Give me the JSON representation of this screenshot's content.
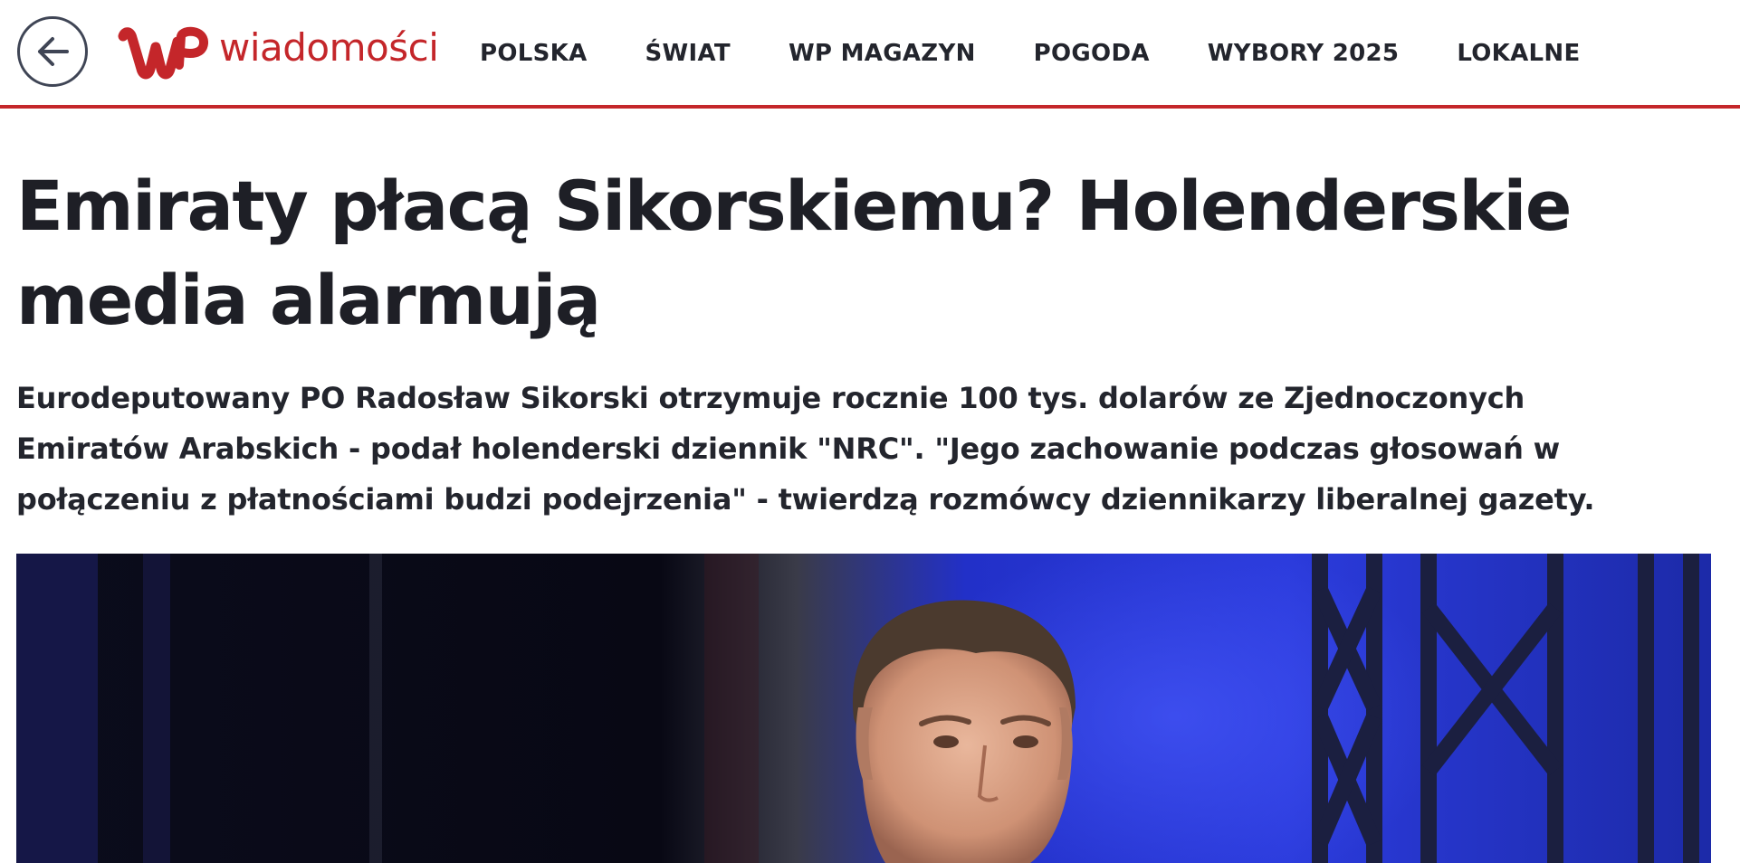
{
  "header": {
    "back_icon": "arrow-left-icon",
    "logo": {
      "mark": "WP",
      "text": "wiadomości",
      "brand_color": "#c4262a"
    },
    "nav": [
      {
        "label": "POLSKA"
      },
      {
        "label": "ŚWIAT"
      },
      {
        "label": "WP MAGAZYN"
      },
      {
        "label": "POGODA"
      },
      {
        "label": "WYBORY 2025"
      },
      {
        "label": "LOKALNE"
      }
    ]
  },
  "article": {
    "headline": "Emiraty płacą Sikorskiemu? Holenderskie media alarmują",
    "lead": "Eurodeputowany PO Radosław Sikorski otrzymuje rocznie 100 tys. dolarów ze Zjednoczonych Emiratów Arabskich - podał holenderski dziennik \"NRC\". \"Jego zachowanie podczas głosowań w połączeniu z płatnościami budzi podejrzenia\" - twierdzą rozmówcy dziennikarzy liberalnej gazety.",
    "image_subject": "man-portrait-on-stage"
  },
  "colors": {
    "accent": "#c4262a",
    "text": "#1e1f26",
    "stage_blue": "#2b3bdc"
  }
}
